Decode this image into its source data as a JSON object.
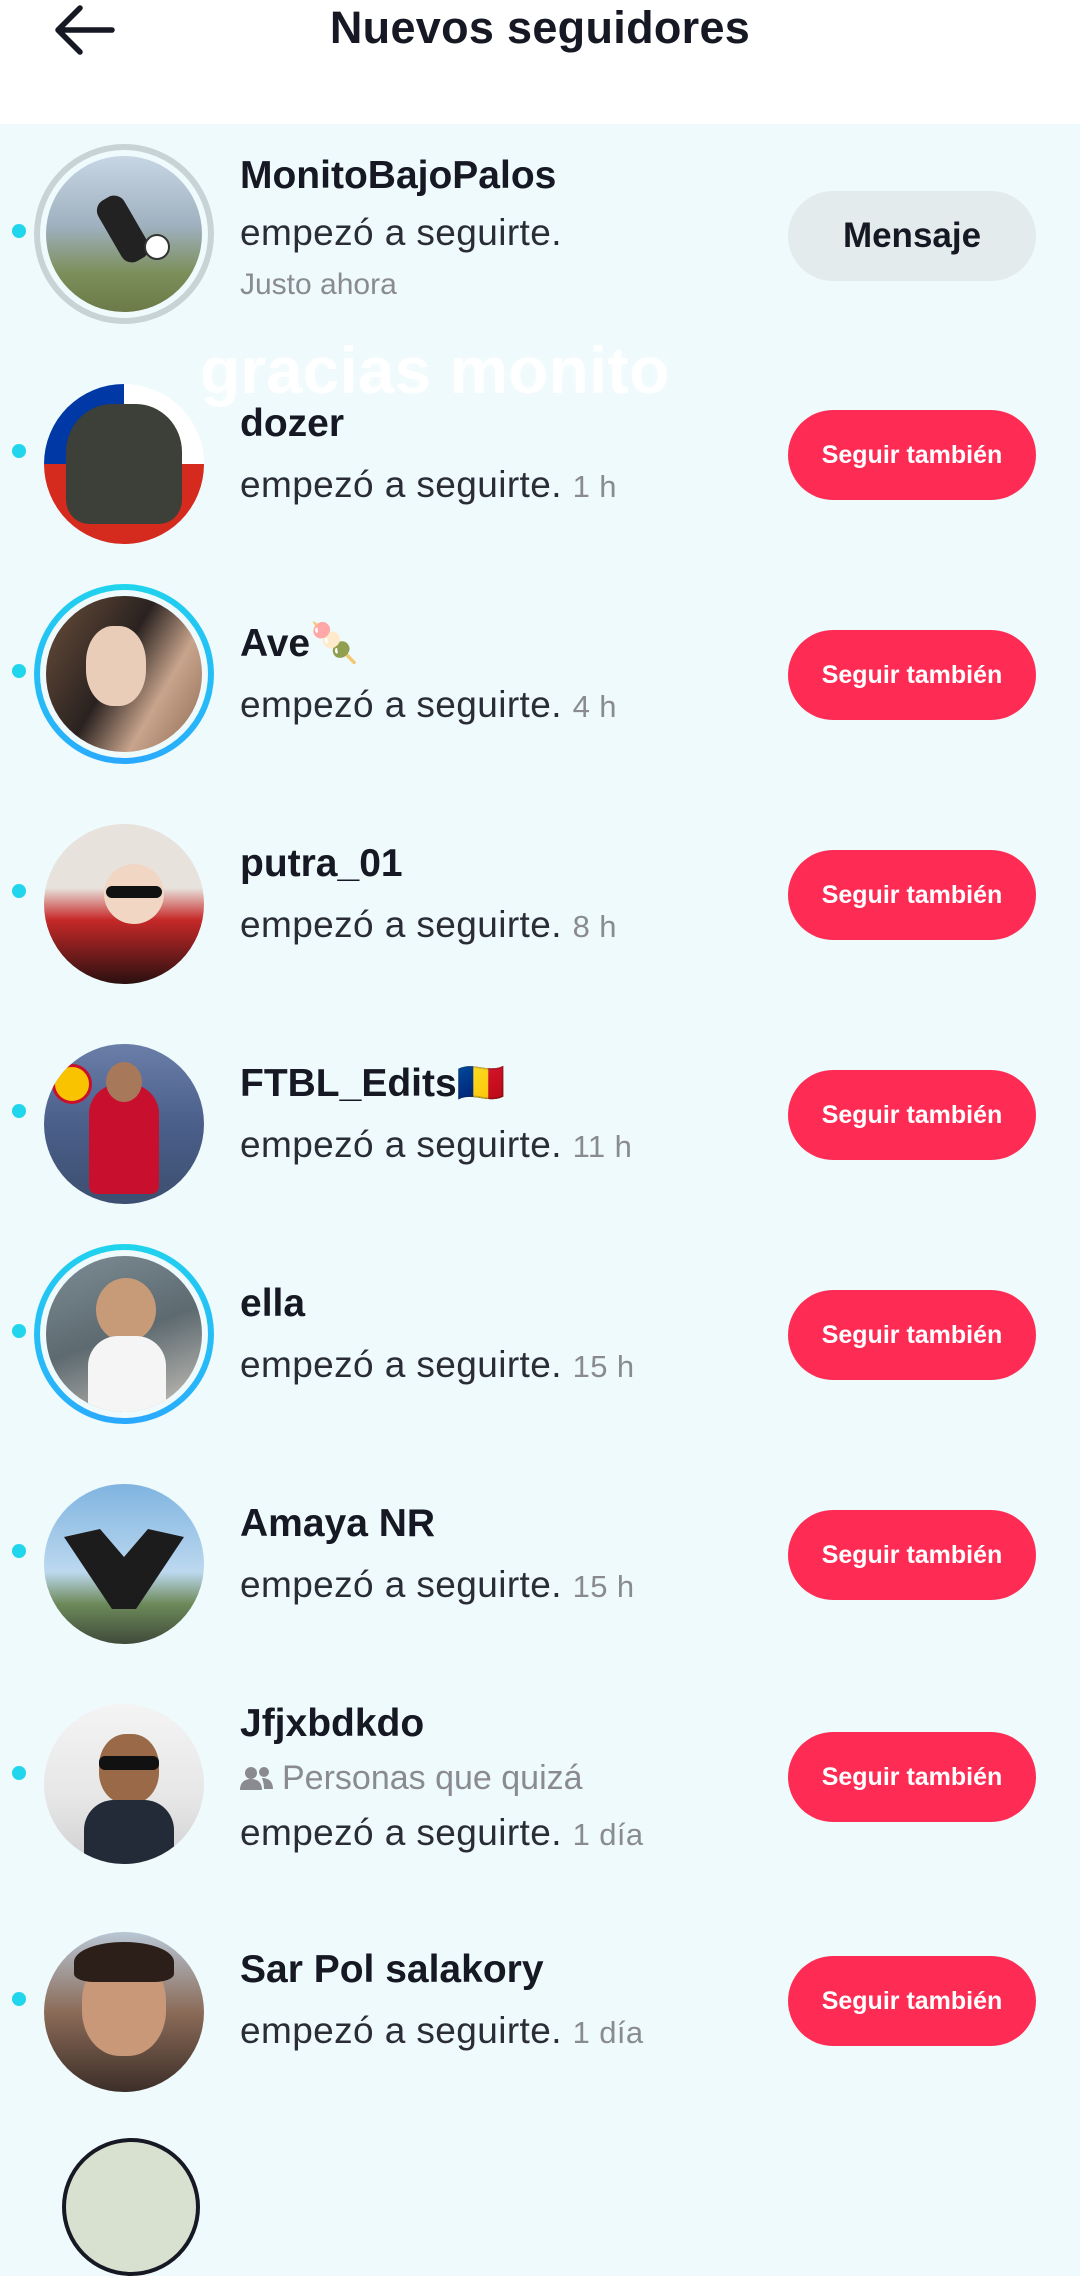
{
  "header": {
    "title": "Nuevos seguidores"
  },
  "overlay_text": "gracias monito",
  "followers": [
    {
      "name": "MonitoBajoPalos",
      "action": "empezó a seguirte.",
      "time": "Justo ahora",
      "button": "Mensaje",
      "button_type": "message"
    },
    {
      "name": "dozer",
      "action": "empezó a seguirte.",
      "time": "1 h",
      "button": "Seguir también",
      "button_type": "follow"
    },
    {
      "name": "Ave🍡",
      "action": "empezó a seguirte.",
      "time": "4 h",
      "button": "Seguir también",
      "button_type": "follow"
    },
    {
      "name": "putra_01",
      "action": "empezó a seguirte.",
      "time": "8 h",
      "button": "Seguir también",
      "button_type": "follow"
    },
    {
      "name": "FTBL_Edits🇷🇴",
      "action": "empezó a seguirte.",
      "time": "11 h",
      "button": "Seguir también",
      "button_type": "follow"
    },
    {
      "name": "ella",
      "action": "empezó a seguirte.",
      "time": "15 h",
      "button": "Seguir también",
      "button_type": "follow"
    },
    {
      "name": "Amaya NR",
      "action": "empezó a seguirte.",
      "time": "15 h",
      "button": "Seguir también",
      "button_type": "follow"
    },
    {
      "name": "Jfjxbdkdo",
      "tag": "Personas que quizá",
      "action": "empezó a seguirte.",
      "time": "1 día",
      "button": "Seguir también",
      "button_type": "follow"
    },
    {
      "name": "Sar Pol salakory",
      "action": "empezó a seguirte.",
      "time": "1 día",
      "button": "Seguir también",
      "button_type": "follow"
    }
  ],
  "colors": {
    "accent": "#fe2c55",
    "unread_dot": "#20d5ec",
    "background": "#eefafc"
  }
}
